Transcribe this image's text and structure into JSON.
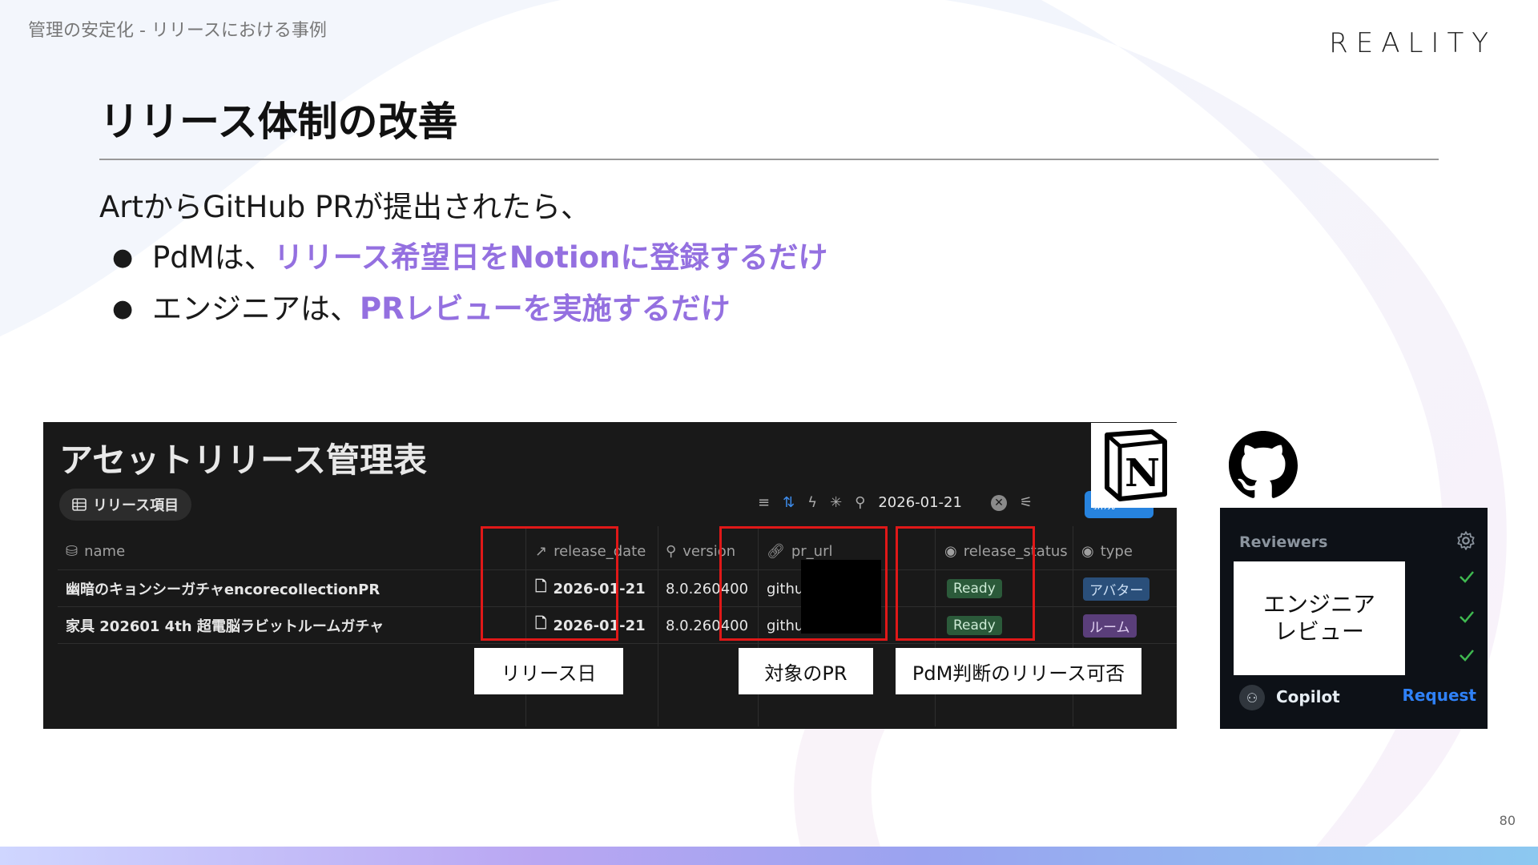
{
  "slide": {
    "breadcrumb": "管理の安定化 - リリースにおける事例",
    "logo": "REALITY",
    "title": "リリース体制の改善",
    "intro": "ArtからGitHub PRが提出されたら、",
    "bullets": [
      {
        "prefix": "PdMは、",
        "highlight": "リリース希望日をNotionに登録するだけ"
      },
      {
        "prefix": "エンジニアは、",
        "highlight": "PRレビューを実施するだけ"
      }
    ],
    "page_number": "80",
    "highlight_color": "#9470e0"
  },
  "notion": {
    "db_title": "アセットリリース管理表",
    "view_tab": "リリース項目",
    "search_value": "2026-01-21",
    "new_button": "新規",
    "columns": [
      {
        "label": "name",
        "icon": "database-icon"
      },
      {
        "label": "release_date",
        "icon": "arrow-up-right-icon"
      },
      {
        "label": "version",
        "icon": "search-icon"
      },
      {
        "label": "pr_url",
        "icon": "link-icon"
      },
      {
        "label": "release_status",
        "icon": "status-icon"
      },
      {
        "label": "type",
        "icon": "status-icon"
      }
    ],
    "rows": [
      {
        "name": "幽暗のキョンシーガチャencorecollectionPR",
        "release_date": "2026-01-21",
        "version": "8.0.260400",
        "pr_url": "github.com",
        "release_status": "Ready",
        "type": "アバター"
      },
      {
        "name": "家具 202601 4th 超電脳ラビットルームガチャ",
        "release_date": "2026-01-21",
        "version": "8.0.260400",
        "pr_url": "github.com",
        "release_status": "Ready",
        "type": "ルーム"
      }
    ],
    "annotations": {
      "release_date": "リリース日",
      "pr_url": "対象のPR",
      "release_status": "PdM判断のリリース可否"
    },
    "annotation_color": "#e01818"
  },
  "github": {
    "reviewers_label": "Reviewers",
    "overlay_line1": "エンジニア",
    "overlay_line2": "レビュー",
    "copilot_label": "Copilot",
    "request_label": "Request"
  }
}
